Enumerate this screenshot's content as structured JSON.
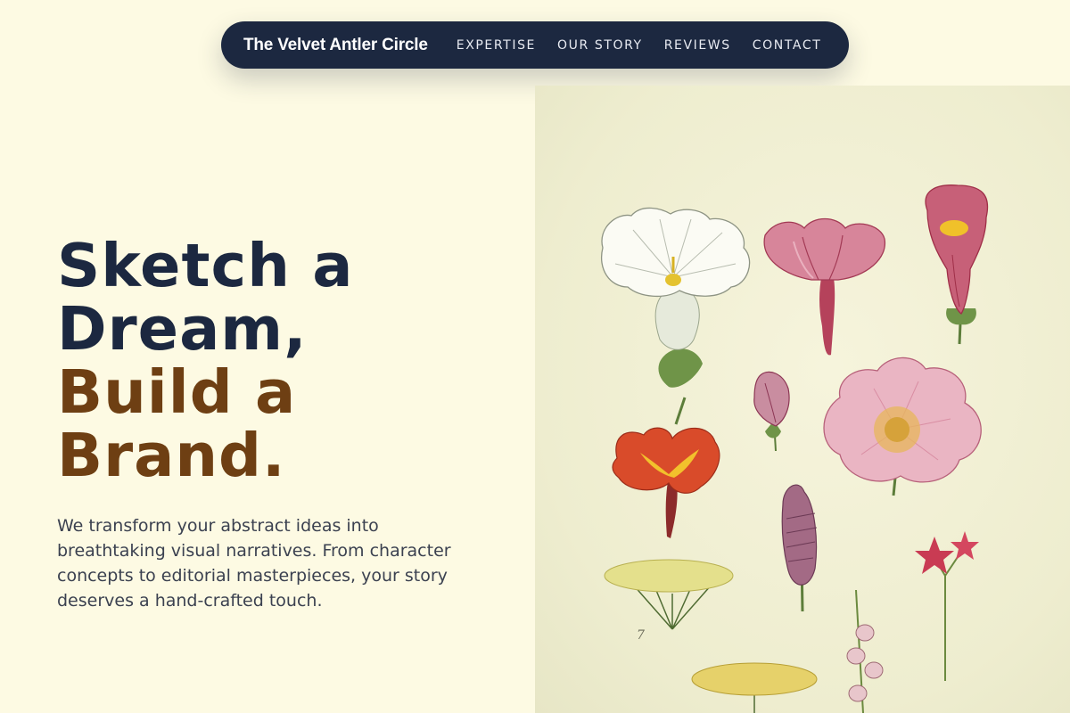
{
  "nav": {
    "brand": "The Velvet Antler Circle",
    "links": [
      "EXPERTISE",
      "OUR STORY",
      "REVIEWS",
      "CONTACT"
    ]
  },
  "hero": {
    "title_line1": "Sketch a",
    "title_line2": "Dream,",
    "title_line3": "Build a",
    "title_line4": "Brand.",
    "description": "We transform your abstract ideas into breathtaking visual narratives. From character concepts to editorial masterpieces, your story deserves a hand-crafted touch."
  },
  "illustration": {
    "plate_number": "7"
  },
  "colors": {
    "background": "#fdfae3",
    "nav_background": "#1c2840",
    "title_dark": "#1c2840",
    "title_accent": "#6e3f13"
  }
}
